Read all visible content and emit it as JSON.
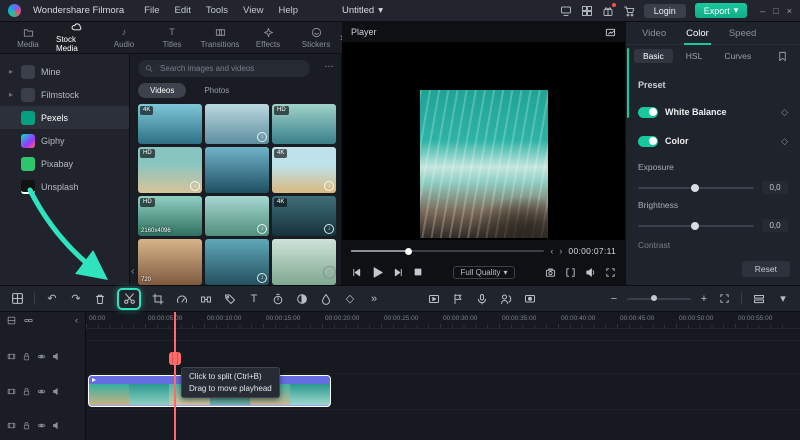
{
  "glyphs": {
    "more_menu": "…",
    "undo": "↶",
    "redo": "↷",
    "double_chevron": "»",
    "keyframe": "◇",
    "download": "↓",
    "expand_row": "▸",
    "collapse_left": "‹",
    "collapse_right": "›",
    "caret_down": "▾",
    "win_min": "–",
    "win_max": "□",
    "win_close": "×",
    "zoom_out": "−",
    "zoom_in": "+",
    "audio_note": "♪",
    "text_tool": "T",
    "info": "i"
  },
  "colors": {
    "accent": "#19c99e",
    "annotation_arrow": "#2fe3bf",
    "playhead": "#ff6b6b",
    "clip_selected_border": "#ffffff"
  },
  "topbar": {
    "app_name": "Wondershare Filmora",
    "menus": [
      "File",
      "Edit",
      "Tools",
      "View",
      "Help"
    ],
    "project_title": "Untitled",
    "login": "Login",
    "export": "Export"
  },
  "media_tabs": {
    "items": [
      "Media",
      "Stock Media",
      "Audio",
      "Titles",
      "Transitions",
      "Effects",
      "Stickers"
    ],
    "active": "Stock Media"
  },
  "sidebar": {
    "items": [
      "Mine",
      "Filmstock",
      "Pexels",
      "Giphy",
      "Pixabay",
      "Unsplash"
    ],
    "active": "Pexels"
  },
  "stock": {
    "search_placeholder": "Search images and videos",
    "tabs": [
      "Videos",
      "Photos"
    ],
    "active_tab": "Videos",
    "thumbs": [
      {
        "badge": "4K",
        "label": ""
      },
      {
        "badge": "",
        "label": ""
      },
      {
        "badge": "HD",
        "label": ""
      },
      {
        "badge": "HD",
        "label": ""
      },
      {
        "badge": "",
        "label": ""
      },
      {
        "badge": "4K",
        "label": ""
      },
      {
        "badge": "HD",
        "label": "2160x4096"
      },
      {
        "badge": "",
        "label": ""
      },
      {
        "badge": "4K",
        "label": ""
      },
      {
        "badge": "",
        "label": "720"
      },
      {
        "badge": "",
        "label": ""
      },
      {
        "badge": "",
        "label": ""
      }
    ]
  },
  "player": {
    "title": "Player",
    "timecode": "00:00:07:11",
    "quality": "Full Quality"
  },
  "color": {
    "tabs": [
      "Video",
      "Color",
      "Speed"
    ],
    "active_tab": "Color",
    "subtabs": [
      "Basic",
      "HSL",
      "Curves"
    ],
    "active_subtab": "Basic",
    "preset_label": "Preset",
    "toggles": [
      {
        "label": "White Balance",
        "on": true
      },
      {
        "label": "Color",
        "on": true
      }
    ],
    "sliders": [
      {
        "label": "Exposure",
        "value": "0,0"
      },
      {
        "label": "Brightness",
        "value": "0,0"
      },
      {
        "label": "Contrast",
        "value": ""
      }
    ],
    "reset": "Reset"
  },
  "toolbar": {
    "icon_names": [
      "snap",
      "undo",
      "redo",
      "delete",
      "split",
      "crop",
      "speed",
      "ripple-delete",
      "marker-tag",
      "text",
      "timer",
      "mask",
      "keyframe",
      "more",
      "render-preview",
      "marker",
      "mic",
      "voiceover",
      "screen-record",
      "zoom-out",
      "zoom-slider",
      "zoom-in",
      "fit-timeline",
      "track-manager"
    ]
  },
  "timeline": {
    "ruler": [
      "00:00",
      "00:00:05:00",
      "00:00:10:00",
      "00:00:15:00",
      "00:00:20:00",
      "00:00:25:00",
      "00:00:30:00",
      "00:00:35:00",
      "00:00:40:00",
      "00:00:45:00",
      "00:00:50:00",
      "00:00:55:00"
    ],
    "tooltip": {
      "line1": "Click to split (Ctrl+B)",
      "line2": "Drag to move playhead"
    }
  }
}
